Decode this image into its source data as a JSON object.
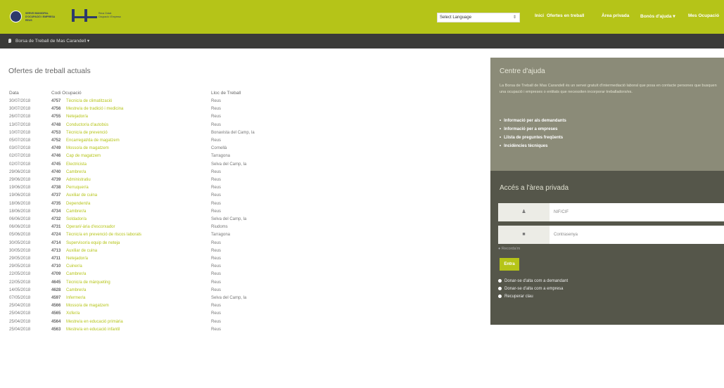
{
  "header": {
    "logo1_text": [
      "SERVEI MUNICIPAL",
      "D'OCUPACIÓ I EMPRESA",
      "REUS"
    ],
    "logo2_text": [
      "Reus Ciutat",
      "Ocupació i Empresa"
    ],
    "language_select": "Select Language",
    "nav": [
      "Inici",
      "Ofertes en treball",
      "Àrea privada",
      "Bonòs d'ajuda ▾",
      "Mes Ocupació"
    ]
  },
  "breadcrumb": "Borsa de Treball de Mas Carandell ▾",
  "main": {
    "title": "Ofertes de treball actuals",
    "columns": [
      "Data",
      "Codi Ocupació",
      "Lloc de Treball"
    ],
    "rows": [
      {
        "date": "30/07/2018",
        "code": "4757",
        "occupation": "Tècnic/a de climatització",
        "place": "Reus"
      },
      {
        "date": "30/07/2018",
        "code": "4756",
        "occupation": "Mestre/a de tradició i medicina",
        "place": "Reus"
      },
      {
        "date": "26/07/2018",
        "code": "4755",
        "occupation": "Netejador/a",
        "place": "Reus"
      },
      {
        "date": "13/07/2018",
        "code": "4748",
        "occupation": "Conductor/a d'autobús",
        "place": "Reus"
      },
      {
        "date": "10/07/2018",
        "code": "4753",
        "occupation": "Tècnic/a de prevenció",
        "place": "Bonavista del Camp, la"
      },
      {
        "date": "05/07/2018",
        "code": "4752",
        "occupation": "Encarregat/da de magatzem",
        "place": "Reus"
      },
      {
        "date": "03/07/2018",
        "code": "4749",
        "occupation": "Mosso/a de magatzem",
        "place": "Cornellà"
      },
      {
        "date": "02/07/2018",
        "code": "4746",
        "occupation": "Cap de magatzem",
        "place": "Tarragona"
      },
      {
        "date": "02/07/2018",
        "code": "4745",
        "occupation": "Electricista",
        "place": "Selva del Camp, la"
      },
      {
        "date": "29/06/2018",
        "code": "4740",
        "occupation": "Cambrer/a",
        "place": "Reus"
      },
      {
        "date": "29/06/2018",
        "code": "4739",
        "occupation": "Administratiu",
        "place": "Reus"
      },
      {
        "date": "19/06/2018",
        "code": "4738",
        "occupation": "Perruquer/a",
        "place": "Reus"
      },
      {
        "date": "19/06/2018",
        "code": "4737",
        "occupation": "Auxiliar de cuina",
        "place": "Reus"
      },
      {
        "date": "18/06/2018",
        "code": "4735",
        "occupation": "Dependent/a",
        "place": "Reus"
      },
      {
        "date": "18/06/2018",
        "code": "4734",
        "occupation": "Cambrer/a",
        "place": "Reus"
      },
      {
        "date": "06/06/2018",
        "code": "4732",
        "occupation": "Soldador/a",
        "place": "Selva del Camp, la"
      },
      {
        "date": "06/06/2018",
        "code": "4731",
        "occupation": "Operari/-ària d'escorxador",
        "place": "Riudoms"
      },
      {
        "date": "05/06/2018",
        "code": "4724",
        "occupation": "Tècnic/a en prevenció de riscos laborals",
        "place": "Tarragona"
      },
      {
        "date": "30/05/2018",
        "code": "4714",
        "occupation": "Supervisor/a equip de neteja",
        "place": "Reus"
      },
      {
        "date": "30/05/2018",
        "code": "4713",
        "occupation": "Auxiliar de cuina",
        "place": "Reus"
      },
      {
        "date": "29/05/2018",
        "code": "4711",
        "occupation": "Netejador/a",
        "place": "Reus"
      },
      {
        "date": "29/05/2018",
        "code": "4710",
        "occupation": "Cuiner/a",
        "place": "Reus"
      },
      {
        "date": "22/05/2018",
        "code": "4709",
        "occupation": "Cambrer/a",
        "place": "Reus"
      },
      {
        "date": "22/05/2018",
        "code": "4645",
        "occupation": "Tècnic/a de màrqueting",
        "place": "Reus"
      },
      {
        "date": "14/05/2018",
        "code": "4628",
        "occupation": "Cambrer/a",
        "place": "Reus"
      },
      {
        "date": "07/05/2018",
        "code": "4597",
        "occupation": "Infermer/a",
        "place": "Selva del Camp, la"
      },
      {
        "date": "25/04/2018",
        "code": "4566",
        "occupation": "Mosso/a de magatzem",
        "place": "Reus"
      },
      {
        "date": "25/04/2018",
        "code": "4565",
        "occupation": "Xofer/a",
        "place": "Reus"
      },
      {
        "date": "25/04/2018",
        "code": "4564",
        "occupation": "Mestre/a en educació primària",
        "place": "Reus"
      },
      {
        "date": "25/04/2018",
        "code": "4563",
        "occupation": "Mestre/a en educació infantil",
        "place": "Reus"
      }
    ]
  },
  "help": {
    "title": "Centre d'ajuda",
    "text": "La Borsa de Treball de Mas Carandell és un servei gratuït d'intermediació laboral que posa en contacte persones que busquen una ocupació i empreses o entitats que necessiten incorporar treballadors/es.",
    "links": [
      "Informació per als demandants",
      "Informació per a empreses",
      "Llista de preguntes freqüents",
      "Incidències tècniques"
    ]
  },
  "login": {
    "title": "Accés a l'àrea privada",
    "user_placeholder": "NIF/CIF",
    "password_placeholder": "Contrasenya",
    "remember": "Recorda'm",
    "button": "Entra",
    "options": [
      "Donar-se d'alta com a demandant",
      "Donar-se d'alta com a empresa",
      "Recuperar clau"
    ]
  },
  "colors": {
    "accent": "#b5c418",
    "dark_bar": "#3a3a38",
    "help_bg": "#8b8b78",
    "login_bg": "#55564a"
  }
}
